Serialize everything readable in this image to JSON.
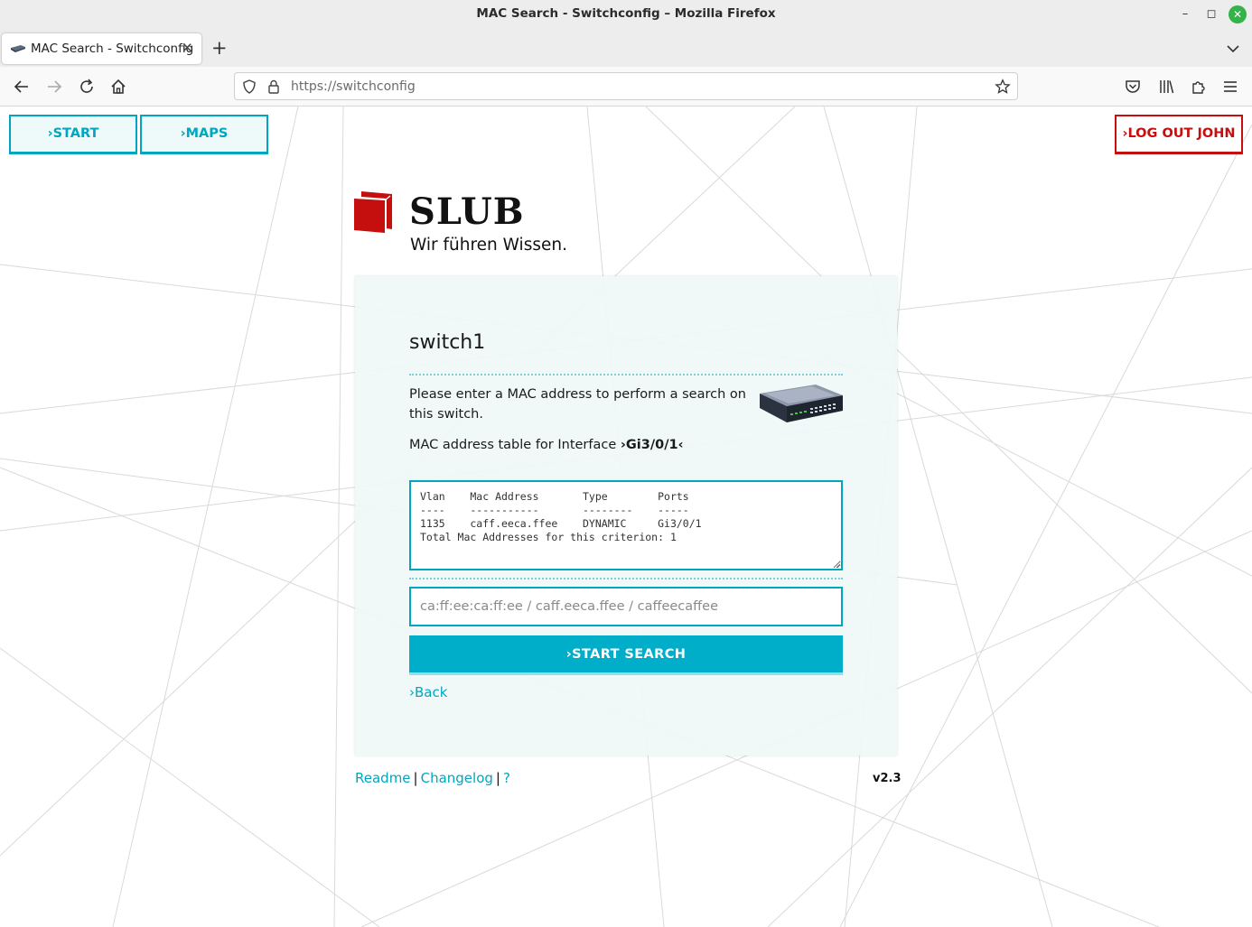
{
  "window": {
    "title": "MAC Search - Switchconfig – Mozilla Firefox",
    "controls": [
      "minimize-icon",
      "maximize-icon",
      "close-icon"
    ]
  },
  "tabs": [
    {
      "label": "MAC Search - Switchconfig",
      "active": true
    }
  ],
  "navigation": {
    "url": "https://switchconfig"
  },
  "header": {
    "start_label": "›START",
    "maps_label": "›MAPS",
    "logout_label": "›LOG OUT JOHN"
  },
  "logo": {
    "brand": "SLUB",
    "slogan": "Wir führen Wissen."
  },
  "panel": {
    "switch_name": "switch1",
    "intro": "Please enter a MAC address to perform a search on this switch.",
    "table_title_prefix": "MAC address table for Interface ",
    "interface": "›Gi3/0/1‹",
    "mac_table_output": "Vlan    Mac Address       Type        Ports\n----    -----------       --------    -----\n1135    caff.eeca.ffee    DYNAMIC     Gi3/0/1\nTotal Mac Addresses for this criterion: 1",
    "search_placeholder": "ca:ff:ee:ca:ff:ee / caff.eeca.ffee / caffeecaffee",
    "search_button_label": "›START SEARCH",
    "back_label": "›Back"
  },
  "footer": {
    "readme": "Readme",
    "changelog": "Changelog",
    "help": "?",
    "separator": "|",
    "version": "v2.3"
  },
  "colors": {
    "accent": "#00a6c0",
    "logout": "#c50e0e",
    "brand_red": "#c50e0e",
    "panel_bg": "#eff8f7"
  }
}
